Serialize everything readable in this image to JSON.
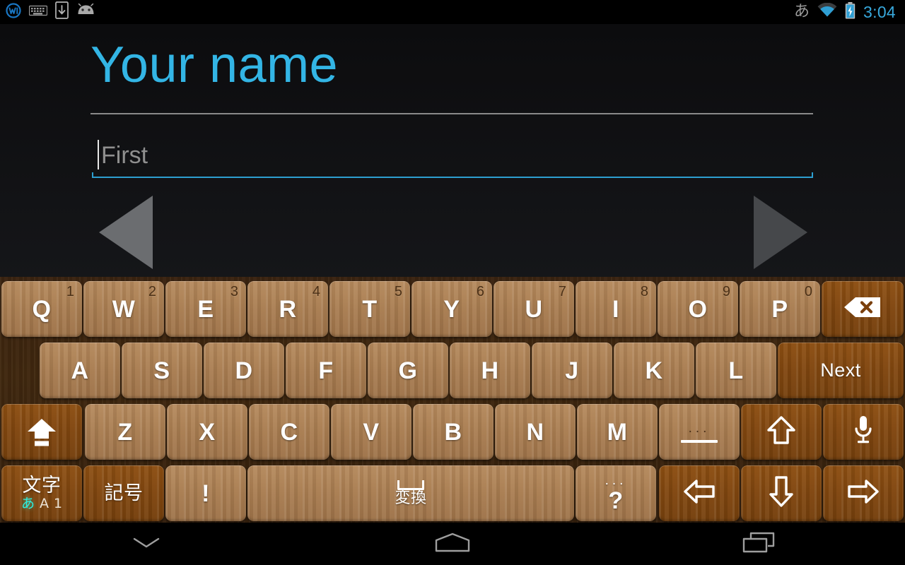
{
  "status_bar": {
    "notifications": [
      {
        "name": "wordpress-logo-icon",
        "label": "W"
      },
      {
        "name": "keyboard-icon",
        "label": "keyboard"
      },
      {
        "name": "download-to-device-icon",
        "label": "download"
      },
      {
        "name": "android-head-icon",
        "label": "android"
      }
    ],
    "ime_indicator": "あ",
    "wifi": "wifi-icon",
    "battery": "battery-charging-icon",
    "clock": "3:04",
    "clock_color": "#38a9dd"
  },
  "content": {
    "title": "Your name",
    "title_color": "#33b5e5",
    "field": {
      "value": "",
      "placeholder": "First",
      "underline_color": "#2d9fd0"
    },
    "prev_label": "Previous",
    "next_label": "Next"
  },
  "keyboard": {
    "row1": [
      {
        "label": "Q",
        "num": "1"
      },
      {
        "label": "W",
        "num": "2"
      },
      {
        "label": "E",
        "num": "3"
      },
      {
        "label": "R",
        "num": "4"
      },
      {
        "label": "T",
        "num": "5"
      },
      {
        "label": "Y",
        "num": "6"
      },
      {
        "label": "U",
        "num": "7"
      },
      {
        "label": "I",
        "num": "8"
      },
      {
        "label": "O",
        "num": "9"
      },
      {
        "label": "P",
        "num": "0"
      }
    ],
    "row2": [
      {
        "label": "A"
      },
      {
        "label": "S"
      },
      {
        "label": "D"
      },
      {
        "label": "F"
      },
      {
        "label": "G"
      },
      {
        "label": "H"
      },
      {
        "label": "J"
      },
      {
        "label": "K"
      },
      {
        "label": "L"
      }
    ],
    "row3": [
      {
        "label": "Z"
      },
      {
        "label": "X"
      },
      {
        "label": "C"
      },
      {
        "label": "V"
      },
      {
        "label": "B"
      },
      {
        "label": "N"
      },
      {
        "label": "M"
      }
    ],
    "backspace": "backspace-icon",
    "enter_label": "Next",
    "shift": "shift-caps-icon",
    "symbol_dots": "...",
    "cursor_up": "arrow-up-icon",
    "mic": "microphone-icon",
    "char_mode_label": "文字",
    "char_mode_sub": [
      "あ",
      "A",
      "1"
    ],
    "char_mode_active": "あ",
    "symbols_label": "記号",
    "exclaim_label": "!",
    "space_label": "変換",
    "question_label": "?",
    "question_dots": "...",
    "cursor_left": "arrow-left-icon",
    "cursor_down": "arrow-down-icon",
    "cursor_right": "arrow-right-icon"
  },
  "navbar": {
    "back": "hide-keyboard-chevron-icon",
    "home": "home-icon",
    "recents": "recents-icon"
  }
}
